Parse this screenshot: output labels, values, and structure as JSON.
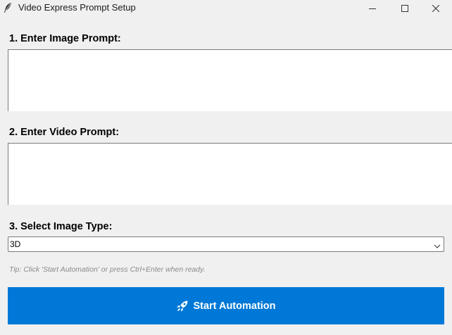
{
  "window": {
    "title": "Video Express Prompt Setup"
  },
  "form": {
    "image_prompt_label": "1. Enter Image Prompt:",
    "image_prompt_value": "",
    "video_prompt_label": "2. Enter Video Prompt:",
    "video_prompt_value": "",
    "image_type_label": "3. Select Image Type:",
    "image_type_selected": "3D",
    "tip": "Tip: Click 'Start Automation' or press Ctrl+Enter when ready.",
    "start_button_label": "Start Automation"
  },
  "icons": {
    "app": "feather-icon",
    "start_button": "rocket-icon",
    "dropdown": "chevron-down-icon"
  },
  "colors": {
    "background": "#f0f0f0",
    "accent": "#0078d7",
    "tip_text": "#8a8a8a"
  }
}
